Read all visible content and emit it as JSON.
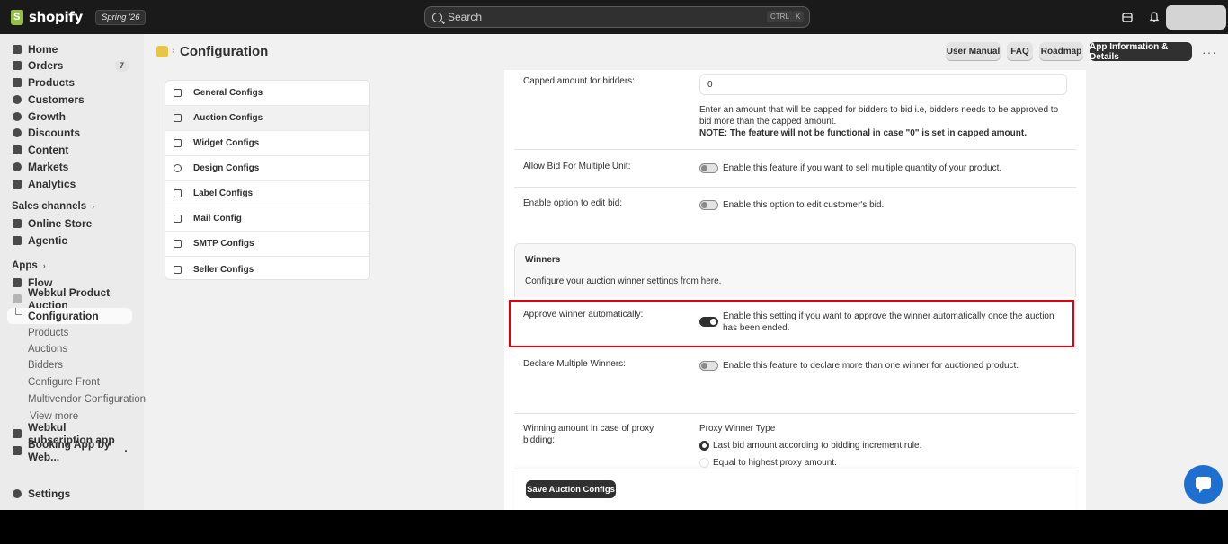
{
  "topbar": {
    "brand": "shopify",
    "edition": "Spring '26",
    "search_placeholder": "Search",
    "shortcut_ctrl": "CTRL",
    "shortcut_key": "K"
  },
  "sidebar": {
    "main": [
      {
        "label": "Home"
      },
      {
        "label": "Orders",
        "count": "7"
      },
      {
        "label": "Products"
      },
      {
        "label": "Customers"
      },
      {
        "label": "Growth"
      },
      {
        "label": "Discounts"
      },
      {
        "label": "Content"
      },
      {
        "label": "Markets"
      },
      {
        "label": "Analytics"
      }
    ],
    "sales_channels_header": "Sales channels",
    "sales_channels": [
      {
        "label": "Online Store"
      },
      {
        "label": "Agentic"
      }
    ],
    "apps_header": "Apps",
    "apps": [
      {
        "label": "Flow"
      },
      {
        "label": "Webkul Product Auction"
      }
    ],
    "app_sub": [
      {
        "label": "Configuration"
      },
      {
        "label": "Products"
      },
      {
        "label": "Auctions"
      },
      {
        "label": "Bidders"
      },
      {
        "label": "Configure Front"
      },
      {
        "label": "Multivendor Configuration"
      },
      {
        "label": "View more"
      }
    ],
    "other_apps": [
      {
        "label": "Webkul subscription app"
      },
      {
        "label": "Booking App by Web..."
      }
    ],
    "settings": "Settings"
  },
  "header": {
    "title": "Configuration",
    "buttons": {
      "user_manual": "User Manual",
      "faq": "FAQ",
      "roadmap": "Roadmap",
      "app_info": "App Information & Details"
    }
  },
  "config_menu": [
    {
      "label": "General Configs"
    },
    {
      "label": "Auction Configs"
    },
    {
      "label": "Widget Configs"
    },
    {
      "label": "Design Configs"
    },
    {
      "label": "Label Configs"
    },
    {
      "label": "Mail Config"
    },
    {
      "label": "SMTP Configs"
    },
    {
      "label": "Seller Configs"
    }
  ],
  "settings": {
    "capped": {
      "label": "Capped amount for bidders:",
      "value": "0",
      "desc": "Enter an amount that will be capped for bidders to bid i.e, bidders needs to be approved to bid more than the capped amount.",
      "note": "NOTE: The feature will not be functional in case \"0\" is set in capped amount."
    },
    "multi_unit": {
      "label": "Allow Bid For Multiple Unit:",
      "desc": "Enable this feature if you want to sell multiple quantity of your product."
    },
    "edit_bid": {
      "label": "Enable option to edit bid:",
      "desc": "Enable this option to edit customer's bid."
    },
    "winners": {
      "title": "Winners",
      "subtitle": "Configure your auction winner settings from here."
    },
    "approve_winner": {
      "label": "Approve winner automatically:",
      "desc": "Enable this setting if you want to approve the winner automatically once the auction has been ended."
    },
    "multiple_winners": {
      "label": "Declare Multiple Winners:",
      "desc": "Enable this feature to declare more than one winner for auctioned product."
    },
    "proxy": {
      "label": "Winning amount in case of proxy bidding:",
      "type_title": "Proxy Winner Type",
      "option1": "Last bid amount according to bidding increment rule.",
      "option2": "Equal to highest proxy amount."
    }
  },
  "save_button": "Save Auction Configs",
  "colors": {
    "topbar": "#1a1a1a",
    "highlight": "#e3000f",
    "chat": "#1f6fd0"
  }
}
